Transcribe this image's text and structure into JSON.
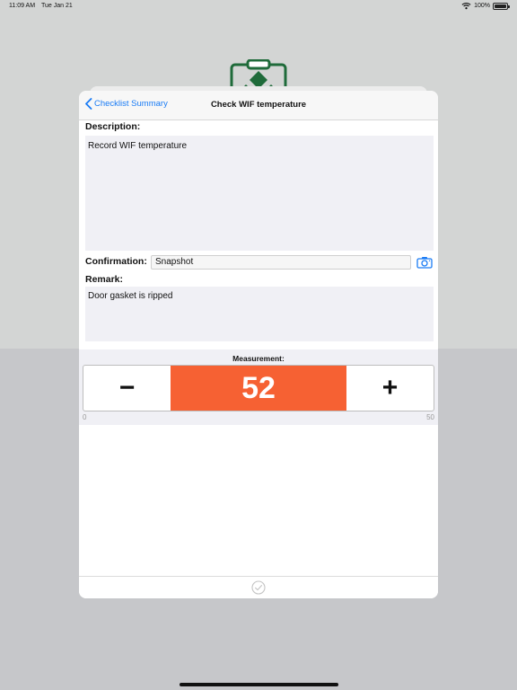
{
  "status_bar": {
    "time": "11:09 AM",
    "date": "Tue Jan 21",
    "battery": "100%",
    "battery_level": 1.0
  },
  "nav": {
    "back_label": "Checklist Summary",
    "title": "Check WIF temperature"
  },
  "description": {
    "label": "Description:",
    "value": "Record WIF temperature"
  },
  "confirmation": {
    "label": "Confirmation:",
    "value": "Snapshot"
  },
  "remark": {
    "label": "Remark:",
    "value": "Door gasket is ripped"
  },
  "measurement": {
    "label": "Measurement:",
    "value": "52",
    "decrement_label": "−",
    "increment_label": "+",
    "min": "0",
    "max": "50",
    "highlight_color": "#f66133"
  },
  "colors": {
    "accent": "#1a7cf5",
    "brand": "#1f6b3a"
  },
  "icons": {
    "back": "chevron-left-icon",
    "camera": "camera-icon",
    "done": "checkmark-circle-icon",
    "logo": "clipboard-logo-icon",
    "wifi": "wifi-icon",
    "battery": "battery-icon"
  }
}
